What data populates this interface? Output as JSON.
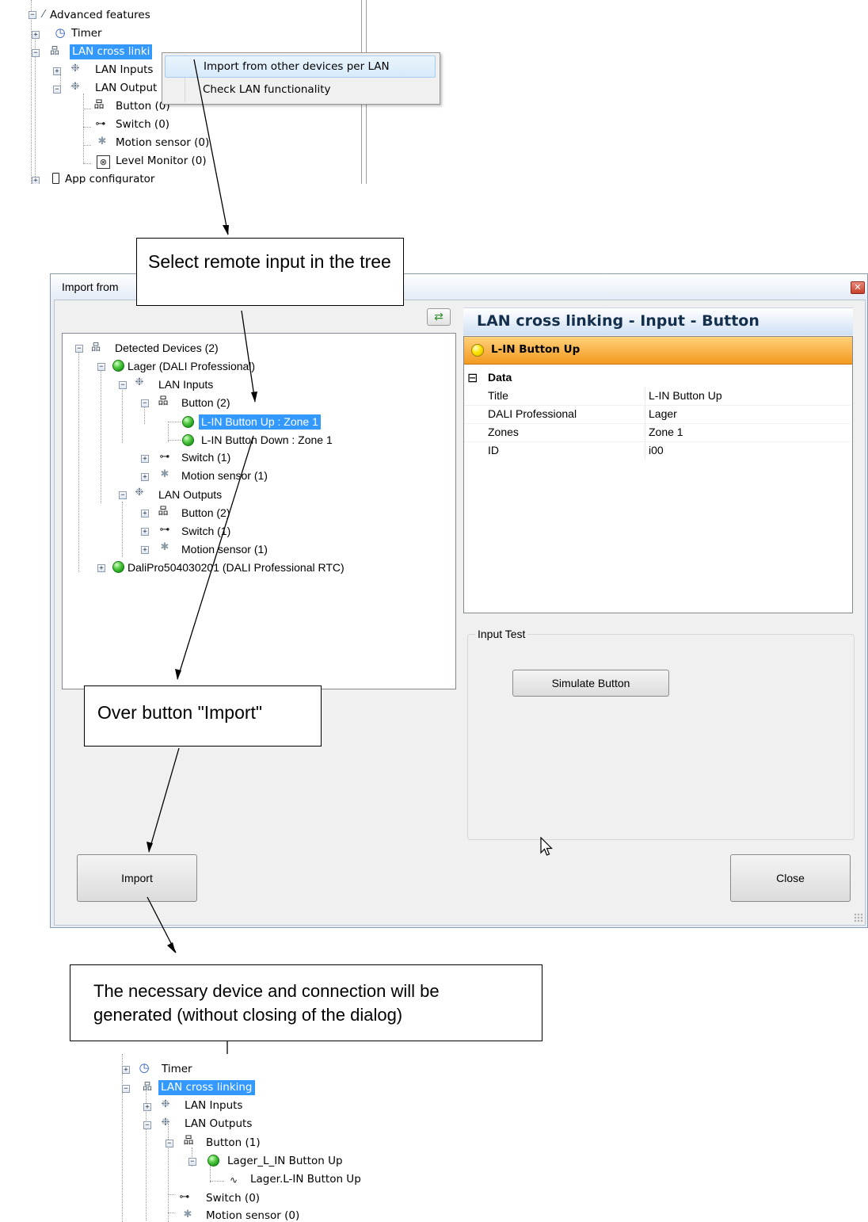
{
  "top_tree": {
    "advanced_features": "Advanced features",
    "timer": "Timer",
    "lan_cross_linking": "LAN cross linki",
    "lan_inputs": "LAN Inputs",
    "lan_outputs": "LAN Output",
    "button": "Button (0)",
    "switch": "Switch (0)",
    "motion_sensor": "Motion sensor (0)",
    "level_monitor": "Level Monitor (0)",
    "app_configurator": "App configurator"
  },
  "context_menu": {
    "items": [
      "Import from other devices per LAN",
      "Check LAN functionality"
    ]
  },
  "callouts": {
    "select": "Select remote input in the tree",
    "over_button": "Over button \"Import\"",
    "generated": "The necessary device and connection will be generated (without closing of the dialog)"
  },
  "dialog": {
    "title": "Import from",
    "tree": {
      "detected_devices": "Detected Devices (2)",
      "lager": "Lager (DALI Professional)",
      "lan_inputs": "LAN Inputs",
      "button": "Button (2)",
      "btn_up": "L-IN Button Up : Zone 1",
      "btn_down": "L-IN Button Down : Zone 1",
      "switch": "Switch (1)",
      "motion": "Motion sensor (1)",
      "lan_outputs": "LAN Outputs",
      "out_button": "Button (2)",
      "out_switch": "Switch (1)",
      "out_motion": "Motion sensor (1)",
      "dalipro": "DaliPro504030201 (DALI Professional RTC)"
    },
    "panel": {
      "header": "LAN cross linking - Input - Button",
      "selected": "L-IN Button Up",
      "section": "Data",
      "rows": [
        {
          "key": "Title",
          "value": "L-IN Button Up"
        },
        {
          "key": "DALI Professional",
          "value": "Lager"
        },
        {
          "key": "Zones",
          "value": "Zone 1"
        },
        {
          "key": "ID",
          "value": "i00"
        }
      ]
    },
    "input_test": {
      "label": "Input Test",
      "simulate_button": "Simulate Button"
    },
    "import_button": "Import",
    "close_button": "Close"
  },
  "bottom_tree": {
    "timer": "Timer",
    "lan_cross_linking": "LAN cross linking",
    "lan_inputs": "LAN Inputs",
    "lan_outputs": "LAN Outputs",
    "button": "Button (1)",
    "lager_button": "Lager_L_IN Button Up",
    "connection": "Lager.L-IN Button Up",
    "switch": "Switch (0)",
    "motion": "Motion sensor (0)"
  }
}
